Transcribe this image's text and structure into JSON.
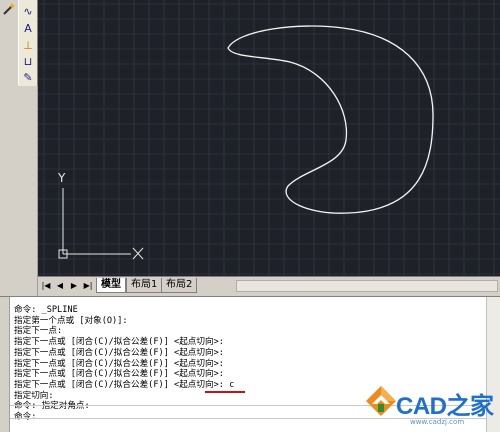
{
  "toolbar": {
    "tools": [
      "spline-tool",
      "text-align-tool",
      "dimension-tool",
      "move-tool",
      "paint-tool"
    ],
    "tool_glyphs": [
      "∿",
      "A",
      "⊥",
      "⊔",
      "✎"
    ]
  },
  "drawing": {
    "background": "#1e2128",
    "grid_color": "#3a3f4a",
    "curve_color": "#f4f4f4",
    "ucs_color": "#e6e6e6",
    "ucs_y_label": "Y",
    "ucs_x_label": "X"
  },
  "tabs": {
    "nav_arrows": [
      "|◀",
      "◀",
      "▶",
      "▶|"
    ],
    "items": [
      "模型",
      "布局1",
      "布局2"
    ],
    "active_index": 0
  },
  "command": {
    "lines": [
      "命令: _SPLINE",
      "指定第一个点或 [对象(O)]:",
      "指定下一点:",
      "指定下一点或 [闭合(C)/拟合公差(F)] <起点切向>:",
      "指定下一点或 [闭合(C)/拟合公差(F)] <起点切向>:",
      "指定下一点或 [闭合(C)/拟合公差(F)] <起点切向>:",
      "指定下一点或 [闭合(C)/拟合公差(F)] <起点切向>:",
      "指定下一点或 [闭合(C)/拟合公差(F)] <起点切向>: c",
      "指定切向:",
      "命令: 指定对角点:",
      "命令:"
    ],
    "highlight_color": "#d01010"
  },
  "watermark": {
    "brand": "CAD之家",
    "url": "www.cadzj.com"
  }
}
